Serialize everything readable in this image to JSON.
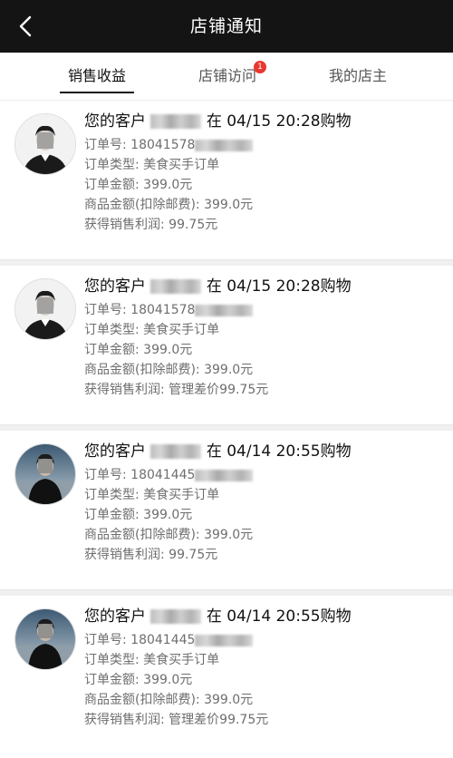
{
  "header": {
    "title": "店铺通知",
    "back_icon": "chevron-left-icon"
  },
  "tabs": [
    {
      "label": "销售收益",
      "active": true
    },
    {
      "label": "店铺访问",
      "active": false,
      "badge": "1"
    },
    {
      "label": "我的店主",
      "active": false
    }
  ],
  "colors": {
    "topbar": "#141414",
    "badge": "#e8382f",
    "text_primary": "#111111",
    "text_secondary": "#6e6e6e"
  },
  "notifications": [
    {
      "prefix": "您的客户",
      "time": "在 04/15 20:28购物",
      "order_no_label": "订单号:",
      "order_no": "18041578",
      "order_type_label": "订单类型:",
      "order_type": "美食买手订单",
      "order_amount_label": "订单金额:",
      "order_amount": "399.0元",
      "goods_amount_label": "商品金额(扣除邮费):",
      "goods_amount": "399.0元",
      "profit_label": "获得销售利润:",
      "profit": "99.75元"
    },
    {
      "prefix": "您的客户",
      "time": "在 04/15 20:28购物",
      "order_no_label": "订单号:",
      "order_no": "18041578",
      "order_type_label": "订单类型:",
      "order_type": "美食买手订单",
      "order_amount_label": "订单金额:",
      "order_amount": "399.0元",
      "goods_amount_label": "商品金额(扣除邮费):",
      "goods_amount": "399.0元",
      "profit_label": "获得销售利润:",
      "profit": "管理差价99.75元"
    },
    {
      "prefix": "您的客户",
      "time": "在 04/14 20:55购物",
      "order_no_label": "订单号:",
      "order_no": "18041445",
      "order_type_label": "订单类型:",
      "order_type": "美食买手订单",
      "order_amount_label": "订单金额:",
      "order_amount": "399.0元",
      "goods_amount_label": "商品金额(扣除邮费):",
      "goods_amount": "399.0元",
      "profit_label": "获得销售利润:",
      "profit": "99.75元"
    },
    {
      "prefix": "您的客户",
      "time": "在 04/14 20:55购物",
      "order_no_label": "订单号:",
      "order_no": "18041445",
      "order_type_label": "订单类型:",
      "order_type": "美食买手订单",
      "order_amount_label": "订单金额:",
      "order_amount": "399.0元",
      "goods_amount_label": "商品金额(扣除邮费):",
      "goods_amount": "399.0元",
      "profit_label": "获得销售利润:",
      "profit": "管理差价99.75元"
    }
  ]
}
